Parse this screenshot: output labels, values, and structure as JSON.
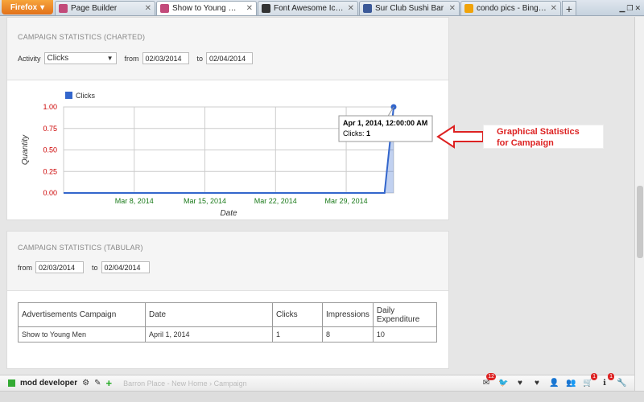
{
  "browser": {
    "menu_label": "Firefox",
    "tabs": [
      {
        "label": "Page Builder",
        "icon_color": "#c24a7a",
        "active": false
      },
      {
        "label": "Show to Young Men",
        "icon_color": "#c24a7a",
        "active": true
      },
      {
        "label": "Font Awesome Icons",
        "icon_color": "#333333",
        "active": false
      },
      {
        "label": "Sur Club Sushi Bar",
        "icon_color": "#3b5998",
        "active": false
      },
      {
        "label": "condo pics - Bing Images",
        "icon_color": "#f0a30a",
        "active": false
      }
    ],
    "new_tab_label": "+"
  },
  "charted": {
    "title": "CAMPAIGN STATISTICS (CHARTED)",
    "activity_label": "Activity",
    "activity_value": "Clicks",
    "from_label": "from",
    "from_value": "02/03/2014",
    "to_label": "to",
    "to_value": "02/04/2014"
  },
  "chart_data": {
    "type": "area",
    "title": "",
    "legend": [
      "Clicks"
    ],
    "legend_position": "top-left",
    "xlabel": "Date",
    "ylabel": "Quantity",
    "x_tick_labels": [
      "Mar 8, 2014",
      "Mar 15, 2014",
      "Mar 22, 2014",
      "Mar 29, 2014"
    ],
    "x_tick_days": [
      8,
      15,
      22,
      29
    ],
    "xlim_days": [
      1,
      33.7
    ],
    "ylim": [
      0,
      1
    ],
    "y_ticks": [
      "0.00",
      "0.25",
      "0.50",
      "0.75",
      "1.00"
    ],
    "grid": true,
    "series": [
      {
        "name": "Clicks",
        "color": "#3366cc",
        "points": [
          {
            "x_day": 1,
            "y": 0
          },
          {
            "x_day": 32.8,
            "y": 0
          },
          {
            "x_day": 33.7,
            "y": 1
          }
        ]
      }
    ],
    "tooltip": {
      "title": "Apr 1, 2014, 12:00:00 AM",
      "label": "Clicks:",
      "value": "1"
    }
  },
  "annotation": {
    "line1": "Graphical Statistics",
    "line2": "for Campaign",
    "color": "#dd2222"
  },
  "tabular": {
    "title": "CAMPAIGN STATISTICS (TABULAR)",
    "from_label": "from",
    "from_value": "02/03/2014",
    "to_label": "to",
    "to_value": "02/04/2014",
    "headers": [
      "Advertisements Campaign",
      "Date",
      "Clicks",
      "Impressions",
      "Daily Expenditure"
    ],
    "rows": [
      [
        "Show to Young Men",
        "April 1, 2014",
        "1",
        "8",
        "10"
      ]
    ]
  },
  "bottombar": {
    "user": "mod developer",
    "crumb1": "Barron Place - New Home",
    "crumb2": "Campaign",
    "badges": {
      "messages": "12",
      "cart": "1",
      "info": "1"
    }
  }
}
